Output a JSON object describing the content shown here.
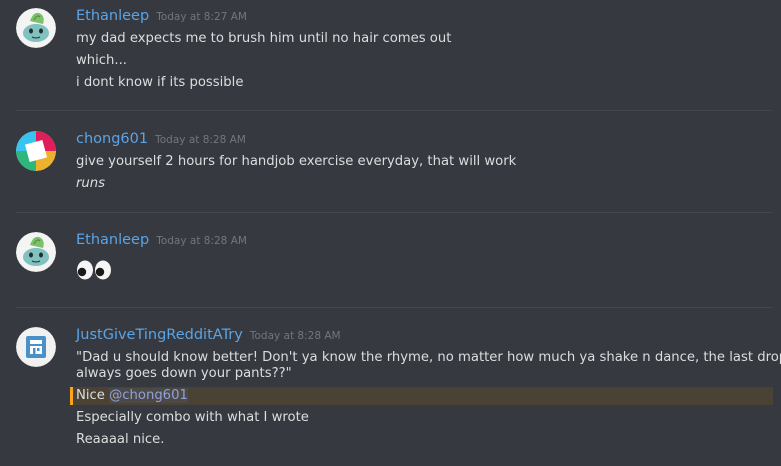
{
  "messages": [
    {
      "username": "Ethanleep",
      "timestamp": "Today at 8:27 AM",
      "lines": [
        "my dad expects me to brush him until no hair comes out",
        "which...",
        "i dont know if its possible"
      ]
    },
    {
      "username": "chong601",
      "timestamp": "Today at 8:28 AM",
      "lines": [
        "give yourself 2 hours for handjob exercise everyday, that will work",
        "runs"
      ]
    },
    {
      "username": "Ethanleep",
      "timestamp": "Today at 8:28 AM",
      "emoji": "eyes-emoji"
    },
    {
      "username": "JustGiveTingRedditATry",
      "timestamp": "Today at 8:28 AM",
      "lines": [
        "\"Dad u should know better! Don't ya know the rhyme, no matter how much ya shake n dance, the last drop",
        "always goes down your pants??\""
      ],
      "mention_line": {
        "prefix": "Nice ",
        "mention": "@chong601"
      },
      "after_lines": [
        "Especially combo with what I wrote",
        "Reaaaal nice."
      ]
    }
  ],
  "colors": {
    "background": "#36393f",
    "username": "#5ba4e6",
    "timestamp": "#72767d",
    "text": "#dcddde",
    "mention_highlight": "#faa61a"
  }
}
